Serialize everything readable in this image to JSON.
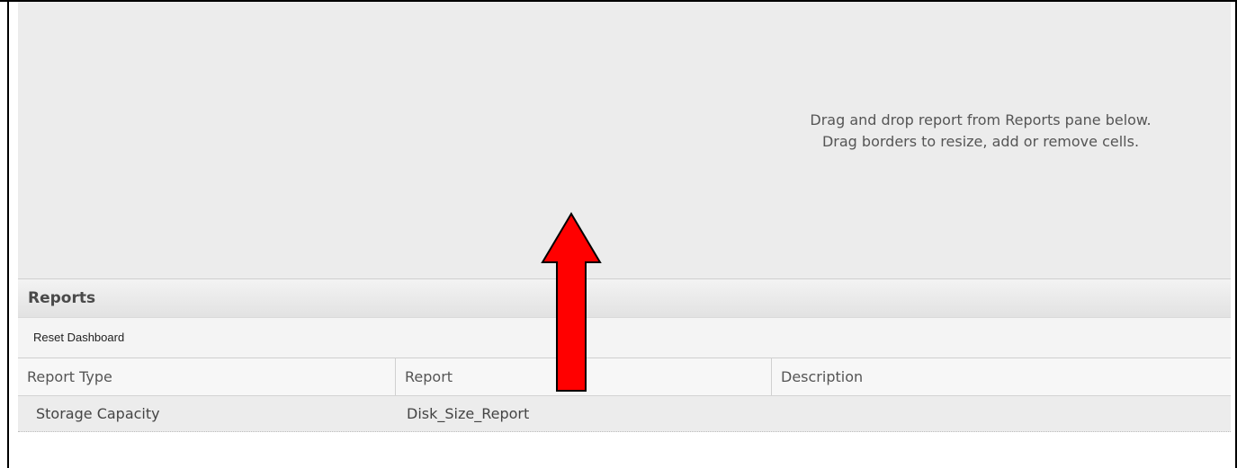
{
  "dashboard": {
    "hint_line1": "Drag and drop report from Reports pane below.",
    "hint_line2": "Drag borders to resize, add or remove cells."
  },
  "reports_panel": {
    "title": "Reports",
    "toolbar": {
      "reset_label": "Reset Dashboard"
    },
    "columns": [
      "Report Type",
      "Report",
      "Description"
    ],
    "rows": [
      {
        "report_type": "Storage Capacity",
        "report": "Disk_Size_Report",
        "description": ""
      }
    ]
  },
  "annotation": {
    "arrow_color": "#ff0000",
    "arrow_direction": "up"
  }
}
